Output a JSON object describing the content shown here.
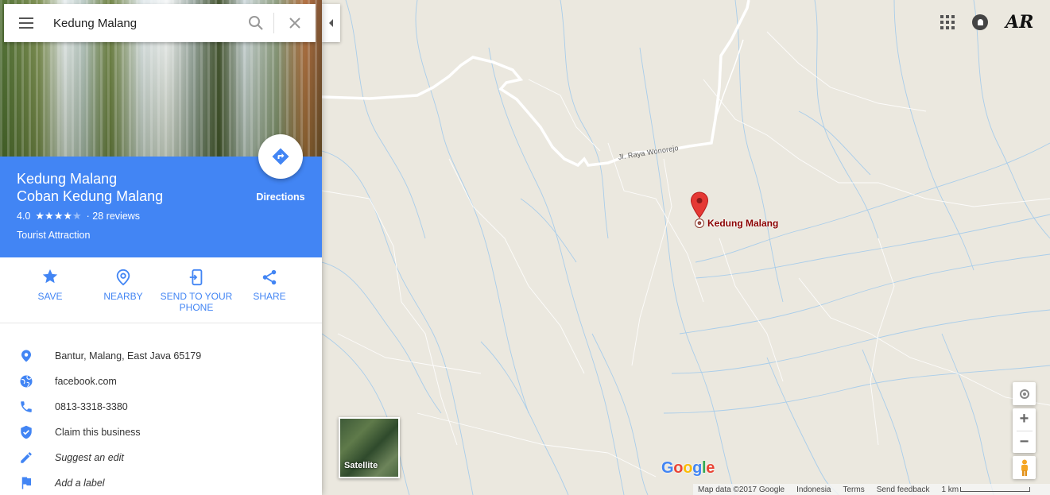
{
  "search": {
    "value": "Kedung Malang"
  },
  "place": {
    "title_line1": "Kedung Malang",
    "title_line2": "Coban Kedung Malang",
    "rating": "4.0",
    "stars": "★★★★",
    "stars_empty": "★",
    "reviews": "· 28 reviews",
    "category": "Tourist Attraction"
  },
  "directions": {
    "label": "Directions"
  },
  "actions": [
    {
      "label": "SAVE"
    },
    {
      "label": "NEARBY"
    },
    {
      "label": "SEND TO YOUR PHONE"
    },
    {
      "label": "SHARE"
    }
  ],
  "info": [
    {
      "icon": "location-pin-icon",
      "text": "Bantur, Malang, East Java 65179"
    },
    {
      "icon": "globe-icon",
      "text": "facebook.com"
    },
    {
      "icon": "phone-icon",
      "text": "0813-3318-3380"
    },
    {
      "icon": "verified-shield-icon",
      "text": "Claim this business"
    },
    {
      "icon": "pencil-icon",
      "text": "Suggest an edit"
    },
    {
      "icon": "flag-icon",
      "text": "Add a label"
    }
  ],
  "map": {
    "road_label": "Jl. Raya Wonorejo",
    "marker_label": "Kedung Malang",
    "satellite_label": "Satellite",
    "google_logo": [
      "G",
      "o",
      "o",
      "g",
      "l",
      "e"
    ],
    "footer": {
      "map_data": "Map data ©2017 Google",
      "country": "Indonesia",
      "terms": "Terms",
      "feedback": "Send feedback",
      "scale": "1 km"
    }
  },
  "colors": {
    "accent": "#4285f4",
    "marker": "#e53935",
    "map_bg": "#ebe8df",
    "stream": "#9cc5e8"
  }
}
